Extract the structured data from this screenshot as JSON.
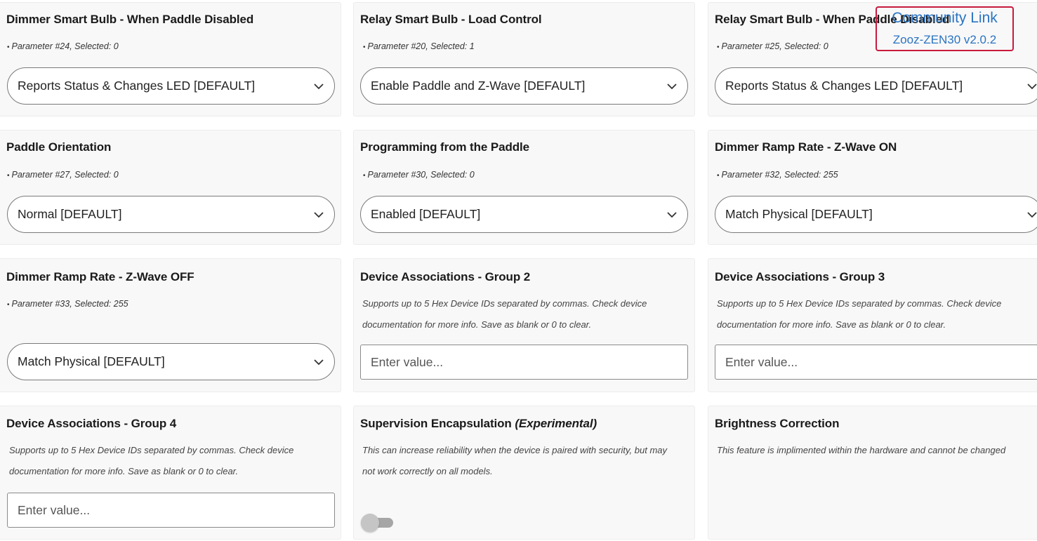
{
  "community": {
    "link_label": "Community Link",
    "device_version": "Zooz-ZEN30 v2.0.2"
  },
  "icons": {
    "dropdown": "chevron-down-icon"
  },
  "colors": {
    "accent_link": "#2a74c3",
    "highlight_border": "#c8193c"
  },
  "cards": [
    {
      "title": "Dimmer Smart Bulb - When Paddle Disabled",
      "param": "Parameter #24, Selected: 0",
      "selected": "Reports Status & Changes LED [DEFAULT]"
    },
    {
      "title": "Relay Smart Bulb - Load Control",
      "param": "Parameter #20, Selected: 1",
      "selected": "Enable Paddle and Z-Wave [DEFAULT]"
    },
    {
      "title": "Relay Smart Bulb - When Paddle Disabled",
      "param": "Parameter #25, Selected: 0",
      "selected": "Reports Status & Changes LED [DEFAULT]"
    },
    {
      "title": "Paddle Orientation",
      "param": "Parameter #27, Selected: 0",
      "selected": "Normal [DEFAULT]"
    },
    {
      "title": "Programming from the Paddle",
      "param": "Parameter #30, Selected: 0",
      "selected": "Enabled [DEFAULT]"
    },
    {
      "title": "Dimmer Ramp Rate - Z-Wave ON",
      "param": "Parameter #32, Selected: 255",
      "selected": "Match Physical [DEFAULT]"
    },
    {
      "title": "Dimmer Ramp Rate - Z-Wave OFF",
      "param": "Parameter #33, Selected: 255",
      "selected": "Match Physical [DEFAULT]"
    },
    {
      "title": "Device Associations - Group 2",
      "desc": "Supports up to 5 Hex Device IDs separated by commas. Check device documentation for more info. Save as blank or 0 to clear.",
      "placeholder": "Enter value..."
    },
    {
      "title": "Device Associations - Group 3",
      "desc": "Supports up to 5 Hex Device IDs separated by commas. Check device documentation for more info. Save as blank or 0 to clear.",
      "placeholder": "Enter value..."
    },
    {
      "title": "Device Associations - Group 4",
      "desc": "Supports up to 5 Hex Device IDs separated by commas. Check device documentation for more info. Save as blank or 0 to clear.",
      "placeholder": "Enter value..."
    },
    {
      "title": "Supervision Encapsulation",
      "title_suffix": "(Experimental)",
      "desc": "This can increase reliability when the device is paired with security, but may not work correctly on all models.",
      "toggle_on": false
    },
    {
      "title": "Brightness Correction",
      "desc": "This feature is implimented within the hardware and cannot be changed"
    }
  ]
}
